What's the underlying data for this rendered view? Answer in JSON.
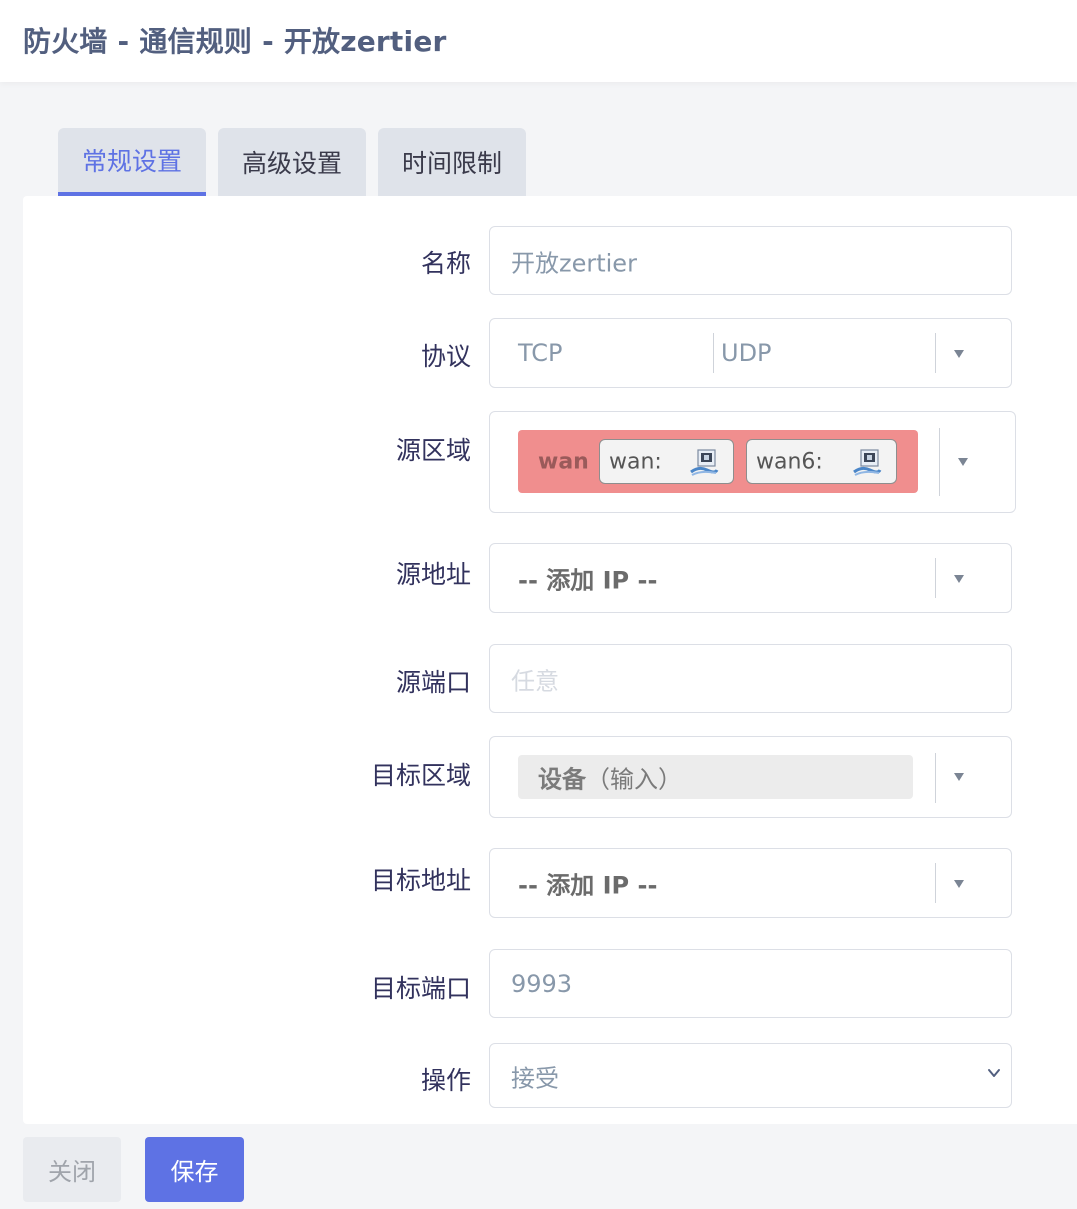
{
  "page": {
    "title": "防火墙 - 通信规则 - 开放zertier"
  },
  "tabs": [
    {
      "label": "常规设置",
      "active": true
    },
    {
      "label": "高级设置",
      "active": false
    },
    {
      "label": "时间限制",
      "active": false
    }
  ],
  "form": {
    "name": {
      "label": "名称",
      "value": "开放zertier"
    },
    "protocol": {
      "label": "协议",
      "values": [
        "TCP",
        "UDP"
      ]
    },
    "src_zone": {
      "label": "源区域",
      "zone": "wan",
      "zone_color": "#f08e8e",
      "networks": [
        "wan:",
        "wan6:"
      ],
      "network_icon": "network-interface-icon"
    },
    "src_ip": {
      "label": "源地址",
      "value": "-- 添加 IP --"
    },
    "src_port": {
      "label": "源端口",
      "placeholder": "任意"
    },
    "dest_zone": {
      "label": "目标区域",
      "value_bold": "设备",
      "value_rest": "（输入）"
    },
    "dest_ip": {
      "label": "目标地址",
      "value": "-- 添加 IP --"
    },
    "dest_port": {
      "label": "目标端口",
      "value": "9993"
    },
    "action": {
      "label": "操作",
      "value": "接受"
    }
  },
  "buttons": {
    "close": "关闭",
    "save": "保存"
  },
  "colors": {
    "accent": "#5e72e4",
    "tab_bg": "#dfe3ea"
  }
}
